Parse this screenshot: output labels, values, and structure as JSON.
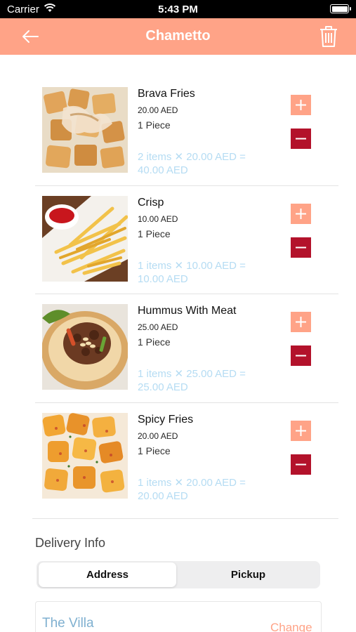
{
  "status_bar": {
    "carrier": "Carrier",
    "time": "5:43 PM"
  },
  "header": {
    "title": "Chametto",
    "back_icon": "arrow-left-icon",
    "delete_icon": "trash-icon",
    "bg_color": "#ffa387"
  },
  "cart": {
    "items": [
      {
        "name": "Brava Fries",
        "price": "20.00 AED",
        "qty": "1 Piece",
        "total": "2 items ✕ 20.00 AED = 40.00 AED"
      },
      {
        "name": "Crisp",
        "price": "10.00 AED",
        "qty": "1 Piece",
        "total": "1 items ✕ 10.00 AED = 10.00 AED"
      },
      {
        "name": "Hummus With Meat",
        "price": "25.00 AED",
        "qty": "1 Piece",
        "total": "1 items ✕ 25.00 AED = 25.00 AED"
      },
      {
        "name": "Spicy Fries",
        "price": "20.00 AED",
        "qty": "1 Piece",
        "total": "1 items ✕ 20.00 AED = 20.00 AED"
      }
    ],
    "plus_icon": "plus-icon",
    "minus_icon": "minus-icon",
    "plus_color": "#ffa387",
    "minus_color": "#b3122b",
    "total_color": "#b5dcf3"
  },
  "delivery": {
    "heading": "Delivery Info",
    "tabs": [
      {
        "label": "Address",
        "selected": true
      },
      {
        "label": "Pickup",
        "selected": false
      }
    ],
    "address_name": "The Villa",
    "change_label": "Change"
  }
}
